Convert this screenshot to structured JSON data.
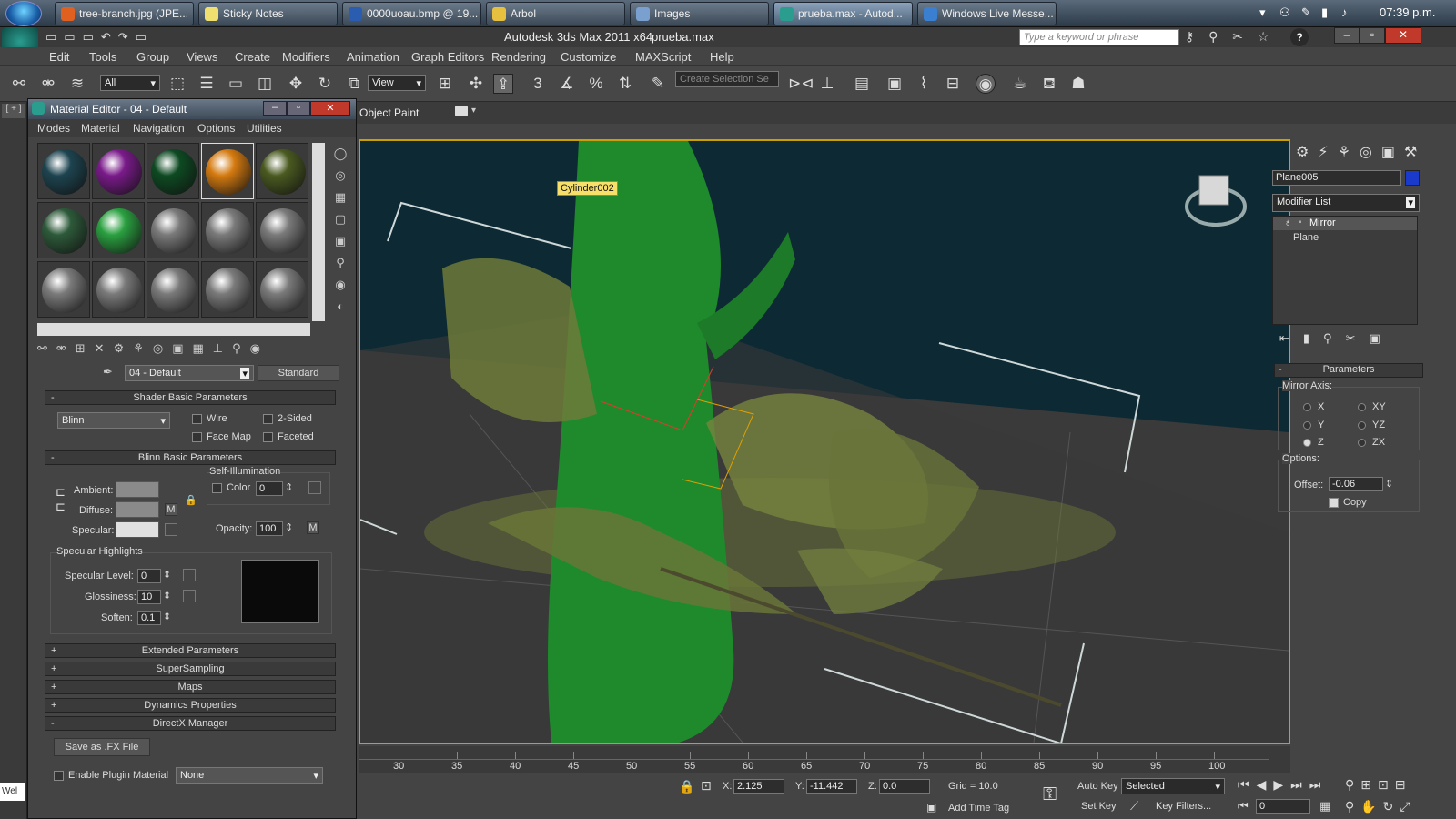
{
  "taskbar": {
    "items": [
      {
        "label": "tree-branch.jpg (JPE...",
        "color": "#e06020"
      },
      {
        "label": "Sticky Notes",
        "color": "#f0e070"
      },
      {
        "label": "0000uoau.bmp @ 19...",
        "color": "#2a5db0"
      },
      {
        "label": "Arbol",
        "color": "#e8c040"
      },
      {
        "label": "Images",
        "color": "#7aa0d0"
      },
      {
        "label": "prueba.max - Autod...",
        "color": "#2a9d8f"
      },
      {
        "label": "Windows Live Messe...",
        "color": "#3a7fd0"
      }
    ],
    "clock": "07:39 p.m."
  },
  "app": {
    "title": "Autodesk 3ds Max  2011 x64",
    "file": "prueba.max",
    "search_placeholder": "Type a keyword or phrase",
    "menus": [
      "Edit",
      "Tools",
      "Group",
      "Views",
      "Create",
      "Modifiers",
      "Animation",
      "Graph Editors",
      "Rendering",
      "Customize",
      "MAXScript",
      "Help"
    ],
    "selection_filter": "All",
    "ref_coord": "View",
    "selection_set_placeholder": "Create Selection Se",
    "object_paint_label": "Object Paint"
  },
  "viewport": {
    "object_tooltip": "Cylinder002",
    "colors": {
      "background": "#0d2a34",
      "trunk": "#1e8a2c",
      "leaves": "#6f7a3a",
      "border": "#c8a000"
    }
  },
  "material_editor": {
    "title": "Material Editor - 04 - Default",
    "menus": [
      "Modes",
      "Material",
      "Navigation",
      "Options",
      "Utilities"
    ],
    "material_name": "04 - Default",
    "material_type": "Standard",
    "shader_rollout": "Shader Basic Parameters",
    "shader": "Blinn",
    "options": [
      "Wire",
      "2-Sided",
      "Face Map",
      "Faceted"
    ],
    "blinn_rollout": "Blinn Basic Parameters",
    "self_illumination": "Self-Illumination",
    "color_label": "Color",
    "color_value": "0",
    "ambient_label": "Ambient:",
    "diffuse_label": "Diffuse:",
    "specular_label": "Specular:",
    "map_button": "M",
    "opacity_label": "Opacity:",
    "opacity_value": "100",
    "specular_highlights": "Specular Highlights",
    "specular_level_label": "Specular Level:",
    "specular_level": "0",
    "glossiness_label": "Glossiness:",
    "glossiness": "10",
    "soften_label": "Soften:",
    "soften": "0.1",
    "rollouts": [
      "Extended Parameters",
      "SuperSampling",
      "Maps",
      "Dynamics Properties"
    ],
    "directx_rollout": "DirectX Manager",
    "save_fx": "Save as .FX File",
    "enable_plugin": "Enable Plugin Material",
    "plugin_value": "None",
    "rollout_plus": "+",
    "rollout_minus": "-",
    "sphere_colors": [
      "#1d4450",
      "#7a1a8a",
      "#0d4a22",
      "#d47a10",
      "#4a5a20",
      "#2d5a3a",
      "#2aa040",
      "#7a7a7a",
      "#7a7a7a",
      "#7a7a7a",
      "#7a7a7a",
      "#7a7a7a",
      "#7a7a7a",
      "#7a7a7a",
      "#7a7a7a"
    ]
  },
  "command_panel": {
    "object_name": "Plane005",
    "object_color": "#1a3acc",
    "modifier_list": "Modifier List",
    "stack": [
      "Mirror",
      "Plane"
    ],
    "parameters": "Parameters",
    "mirror_axis": "Mirror Axis:",
    "axes": [
      "X",
      "XY",
      "Y",
      "YZ",
      "Z",
      "ZX"
    ],
    "selected_axis": "Z",
    "options": "Options:",
    "offset_label": "Offset:",
    "offset": "-0.06",
    "copy": "Copy"
  },
  "timeline": {
    "ticks": [
      "30",
      "35",
      "40",
      "45",
      "50",
      "55",
      "60",
      "65",
      "70",
      "75",
      "80",
      "85",
      "90",
      "95",
      "100"
    ]
  },
  "status": {
    "x_label": "X:",
    "x": "2.125",
    "y_label": "Y:",
    "y": "-11.442",
    "z_label": "Z:",
    "z": "0.0",
    "grid": "Grid = 10.0",
    "add_time_tag": "Add Time Tag",
    "auto_key": "Auto Key",
    "set_key": "Set Key",
    "selected": "Selected",
    "key_filters": "Key Filters...",
    "frame": "0",
    "left_field": "Wel"
  }
}
